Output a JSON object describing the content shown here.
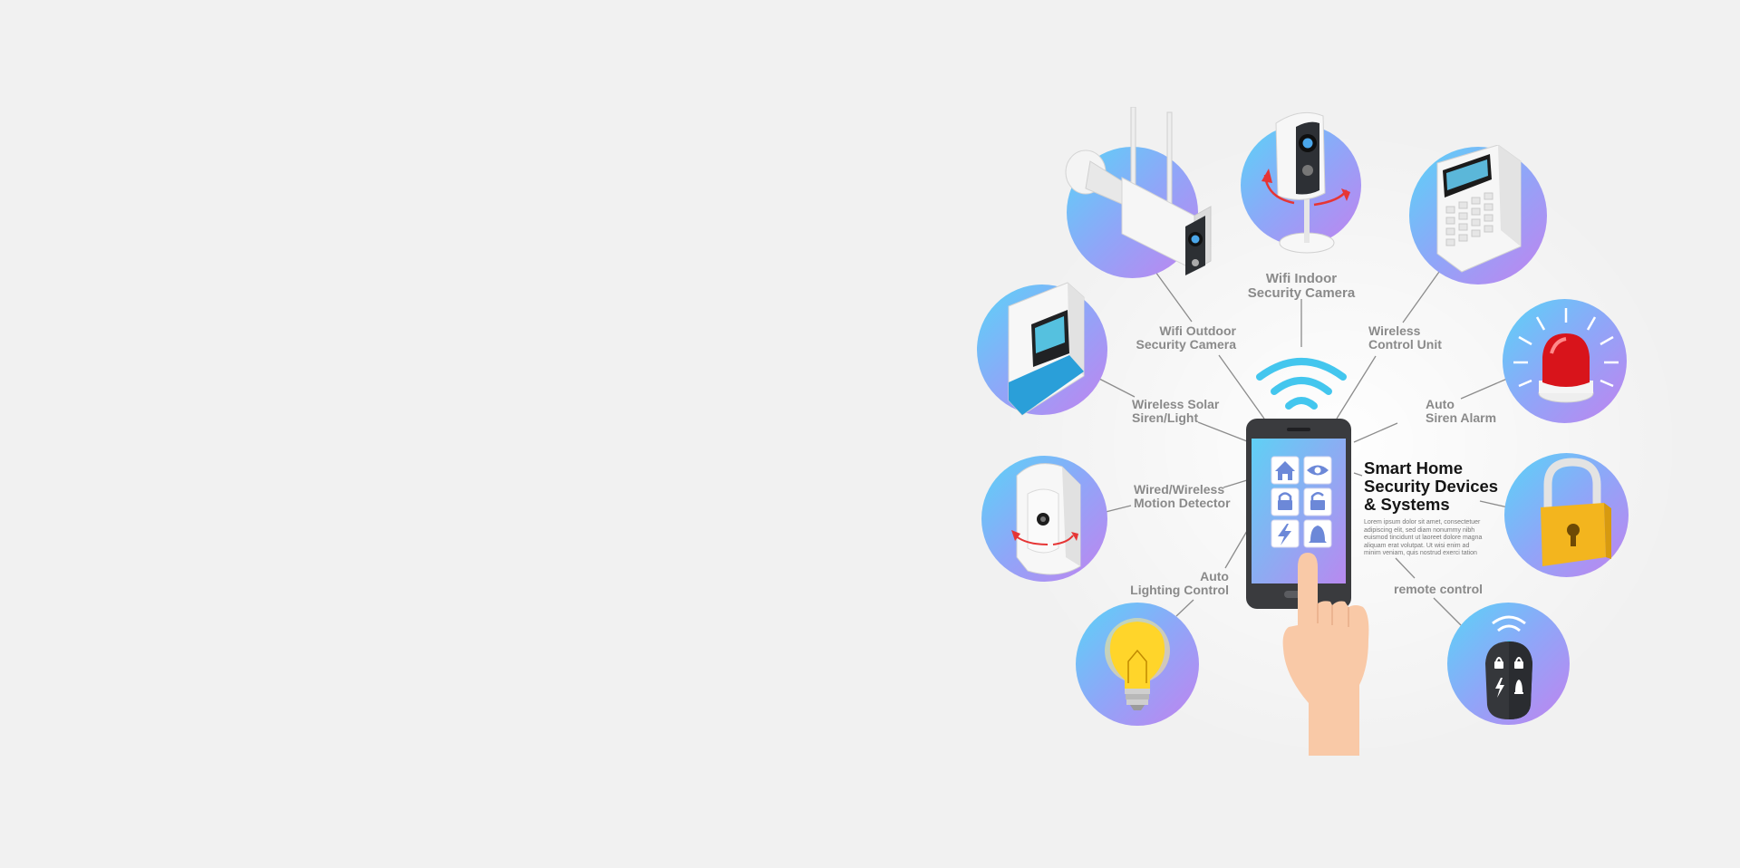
{
  "title": "Smart Home Security Devices & Systems",
  "title_lines": [
    "Smart Home",
    "Security Devices",
    "& Systems"
  ],
  "body_text": "Lorem ipsum dolor sit amet, consectetuer adipiscing elit, sed diam nonummy nibh euismod tincidunt ut laoreet dolore magna aliquam erat volutpat. Ut wisi enim ad minim veniam, quis nostrud exerci tation",
  "devices": [
    {
      "id": "outdoor-camera",
      "label_lines": [
        "Wifi Outdoor",
        "Security Camera"
      ]
    },
    {
      "id": "indoor-camera",
      "label_lines": [
        "Wifi Indoor",
        "Security Camera"
      ]
    },
    {
      "id": "control-unit",
      "label_lines": [
        "Wireless",
        "Control Unit"
      ]
    },
    {
      "id": "solar-siren",
      "label_lines": [
        "Wireless Solar",
        "Siren/Light"
      ]
    },
    {
      "id": "siren-alarm",
      "label_lines": [
        "Auto",
        "Siren Alarm"
      ]
    },
    {
      "id": "motion-detector",
      "label_lines": [
        "Wired/Wireless",
        "Motion Detector"
      ]
    },
    {
      "id": "lock",
      "label_lines": [
        ""
      ]
    },
    {
      "id": "lighting-control",
      "label_lines": [
        "Auto",
        "Lighting Control"
      ]
    },
    {
      "id": "remote-control",
      "label_lines": [
        "remote control"
      ]
    }
  ],
  "colors": {
    "background": "#f1f1f1",
    "circle_start": "#5ad3f7",
    "circle_end": "#c183ef",
    "wifi": "#43c6ee",
    "connector": "#8a8a8a",
    "label": "#8a8a8a",
    "title": "#151515"
  },
  "icons": [
    "wifi-icon",
    "home-icon",
    "eye-icon",
    "lock-icon",
    "unlock-icon",
    "bolt-icon",
    "bell-icon"
  ]
}
